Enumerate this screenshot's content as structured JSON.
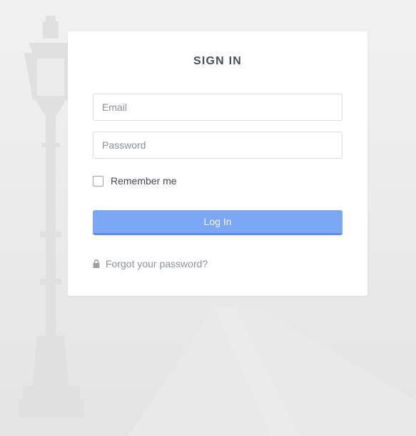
{
  "login_form": {
    "title": "SIGN IN",
    "email": {
      "value": "",
      "placeholder": "Email"
    },
    "password": {
      "value": "",
      "placeholder": "Password"
    },
    "remember_me": {
      "label": "Remember me",
      "checked": false
    },
    "login_button_label": "Log In",
    "forgot_link": {
      "label": "Forgot your password?",
      "icon": "lock-icon"
    }
  },
  "colors": {
    "accent": "#7ba7f5",
    "accent_border": "#5d8be8",
    "title_text": "#4b4f56",
    "muted_text": "#8d9299",
    "card_background": "#ffffff"
  },
  "background": {
    "description_icon": "street-lamp-fog"
  }
}
